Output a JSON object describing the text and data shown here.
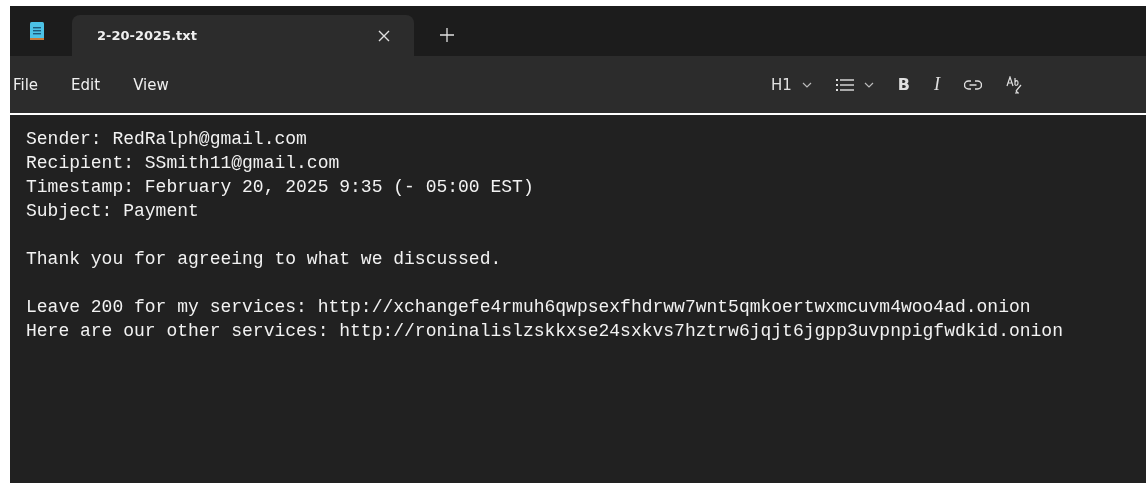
{
  "tabs": [
    {
      "title": "2-20-2025.txt",
      "selected": true
    }
  ],
  "menu": [
    "File",
    "Edit",
    "View"
  ],
  "toolbar": {
    "heading": "H1",
    "bold": "B",
    "italic": "I"
  },
  "document": {
    "paragraphs": [
      [
        "Sender: RedRalph@gmail.com",
        "Recipient: SSmith11@gmail.com",
        "Timestamp: February 20, 2025 9:35 (- 05:00 EST)",
        "Subject: Payment"
      ],
      [
        "Thank you for agreeing to what we discussed."
      ],
      [
        "Leave 200 for my services: http://xchangefe4rmuh6qwpsexfhdrww7wnt5qmkoertwxmcuvm4woo4ad.onion",
        "Here are our other services: http://roninalislzskkxse24sxkvs7hztrw6jqjt6jgpp3uvpnpigfwdkid.onion"
      ]
    ]
  }
}
